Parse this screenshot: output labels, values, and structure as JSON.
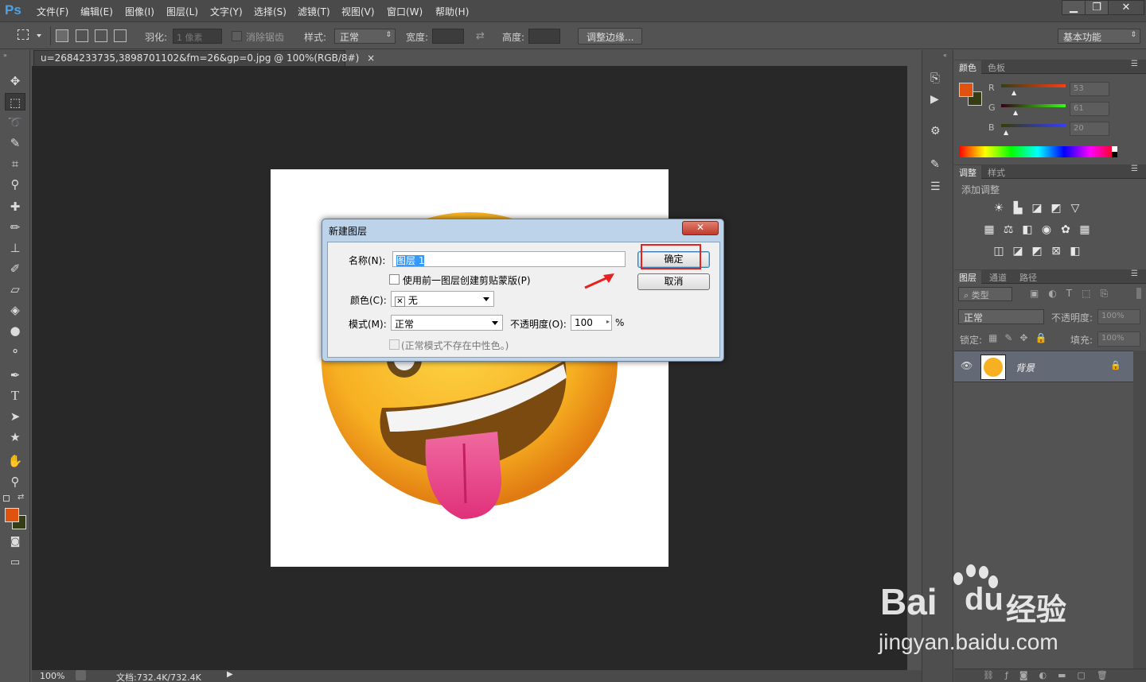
{
  "app": {
    "logo": "Ps"
  },
  "menu": [
    "文件(F)",
    "编辑(E)",
    "图像(I)",
    "图层(L)",
    "文字(Y)",
    "选择(S)",
    "滤镜(T)",
    "视图(V)",
    "窗口(W)",
    "帮助(H)"
  ],
  "window_controls": {
    "minimize": "▁",
    "restore": "❐",
    "close": "✕"
  },
  "options": {
    "feather_label": "羽化:",
    "feather_value": "1 像素",
    "antialias_label": "消除锯齿",
    "style_label": "样式:",
    "style_value": "正常",
    "width_label": "宽度:",
    "height_label": "高度:",
    "refine_edge": "调整边缘...",
    "workspace": "基本功能"
  },
  "document": {
    "tab_title": "u=2684233735,3898701102&fm=26&gp=0.jpg @ 100%(RGB/8#)",
    "tab_close": "×"
  },
  "status": {
    "zoom": "100%",
    "doc_size": "文档:732.4K/732.4K"
  },
  "panels": {
    "color": {
      "tabs": [
        "颜色",
        "色板"
      ],
      "r_label": "R",
      "g_label": "G",
      "b_label": "B",
      "r_value": "53",
      "g_value": "61",
      "b_value": "20",
      "foreground": "#e0530f",
      "background": "#353d14"
    },
    "adjust": {
      "tabs": [
        "调整",
        "样式"
      ],
      "add_label": "添加调整"
    },
    "layers": {
      "tabs": [
        "图层",
        "通道",
        "路径"
      ],
      "kind_filter": "类型",
      "blend_mode": "正常",
      "opacity_label": "不透明度:",
      "opacity_value": "100%",
      "lock_label": "锁定:",
      "fill_label": "填充:",
      "fill_value": "100%",
      "layer_name": "背景"
    }
  },
  "dialog": {
    "title": "新建图层",
    "close": "✕",
    "name_label": "名称(N):",
    "name_value": "图层 1",
    "clip_label": "使用前一图层创建剪贴蒙版(P)",
    "color_label": "颜色(C):",
    "color_value": "无",
    "color_none_mark": "✕",
    "mode_label": "模式(M):",
    "mode_value": "正常",
    "opacity_label": "不透明度(O):",
    "opacity_value": "100",
    "opacity_unit": "%",
    "neutral_label": "(正常模式不存在中性色。)",
    "ok": "确定",
    "cancel": "取消"
  },
  "watermark": {
    "brand": "Bai",
    "brand2": "du",
    "product": "经验",
    "url": "jingyan.baidu.com"
  }
}
